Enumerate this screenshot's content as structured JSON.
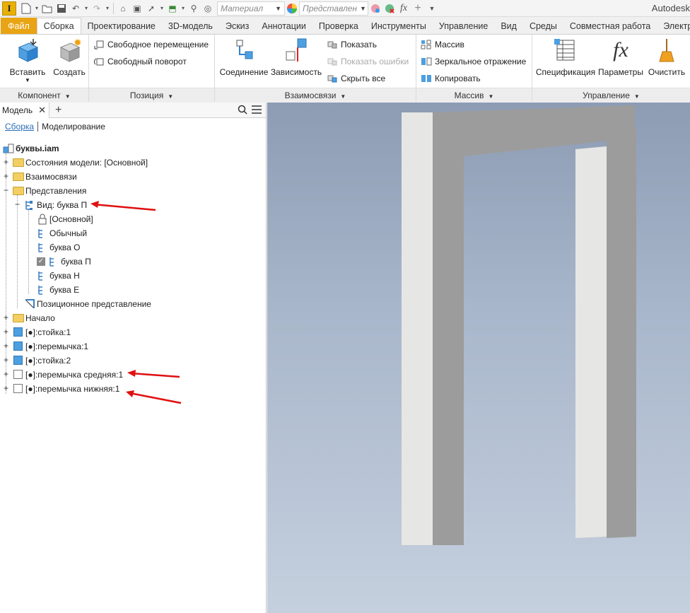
{
  "qat": {
    "material_combo": "Материал",
    "appearance_combo": "Представлен",
    "app_title": "Autodesk"
  },
  "tabs": [
    {
      "label": "Файл"
    },
    {
      "label": "Сборка"
    },
    {
      "label": "Проектирование"
    },
    {
      "label": "3D-модель"
    },
    {
      "label": "Эскиз"
    },
    {
      "label": "Аннотации"
    },
    {
      "label": "Проверка"
    },
    {
      "label": "Инструменты"
    },
    {
      "label": "Управление"
    },
    {
      "label": "Вид"
    },
    {
      "label": "Среды"
    },
    {
      "label": "Совместная работа"
    },
    {
      "label": "Электром"
    }
  ],
  "ribbon": {
    "component": {
      "title": "Компонент",
      "insert": "Вставить",
      "create": "Создать"
    },
    "position": {
      "title": "Позиция",
      "free_move": "Свободное перемещение",
      "free_rotate": "Свободный поворот"
    },
    "relationships": {
      "title": "Взаимосвязи",
      "joint": "Соединение",
      "constrain": "Зависимость",
      "show": "Показать",
      "show_errors": "Показать ошибки",
      "hide_all": "Скрыть все"
    },
    "pattern": {
      "title": "Массив",
      "pattern": "Массив",
      "mirror": "Зеркальное отражение",
      "copy": "Копировать"
    },
    "manage": {
      "title": "Управление",
      "bom": "Спецификация",
      "parameters": "Параметры",
      "purge": "Очистить"
    }
  },
  "browser": {
    "tab_label": "Модель",
    "mode_link": "Сборка",
    "mode_other": "Моделирование",
    "tree": {
      "root": "буквы.iam",
      "model_states": "Состояния модели: [Основной]",
      "relationships": "Взаимосвязи",
      "representations": "Представления",
      "view": "Вид: буква П",
      "view_items": [
        "[Основной]",
        "Обычный",
        "буква О",
        "буква П",
        "буква Н",
        "буква Е"
      ],
      "positional": "Позиционное представление",
      "origin": "Начало",
      "components": [
        "[●]:стойка:1",
        "[●]:перемычка:1",
        "[●]:стойка:2",
        "[●]:перемычка средняя:1",
        "[●]:перемычка нижняя:1"
      ]
    }
  },
  "colors": {
    "file_tab": "#e8a413",
    "accent_blue": "#2a6ebb",
    "annotation_red": "#e01010"
  }
}
